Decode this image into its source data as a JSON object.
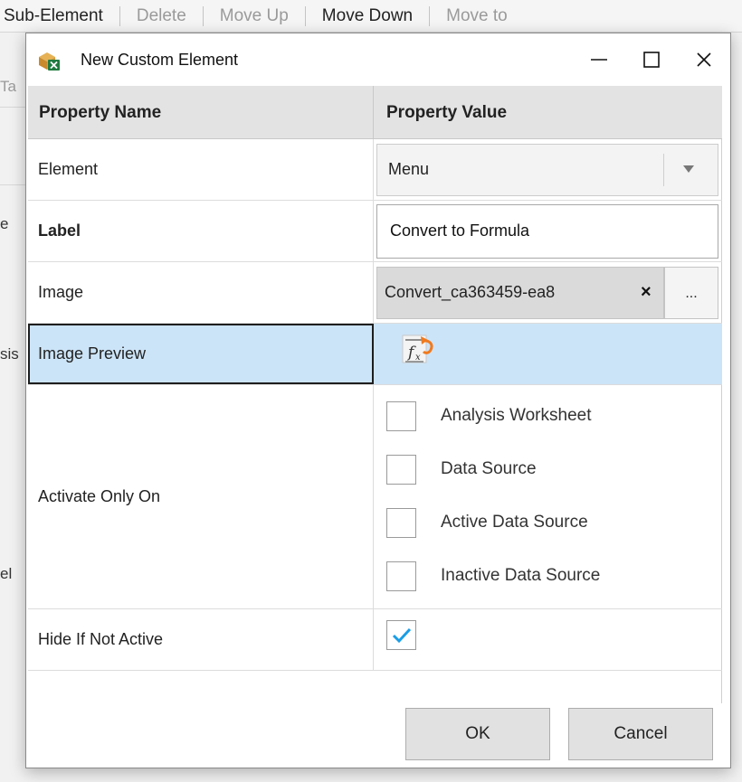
{
  "background": {
    "toolbar": [
      {
        "label": "Sub-Element",
        "enabled": true
      },
      {
        "label": "Delete",
        "enabled": false
      },
      {
        "label": "Move Up",
        "enabled": false
      },
      {
        "label": "Move Down",
        "enabled": true
      },
      {
        "label": "Move to",
        "enabled": false
      }
    ],
    "fragments": [
      "Ta",
      "e",
      "sis",
      "el"
    ]
  },
  "dialog": {
    "title": "New Custom Element",
    "icon": "custom-element-app-icon",
    "window_buttons": [
      "minimize-icon",
      "maximize-icon",
      "close-icon"
    ],
    "grid": {
      "header": {
        "name": "Property Name",
        "value": "Property Value"
      },
      "element": {
        "name": "Element",
        "value": "Menu"
      },
      "label": {
        "name": "Label",
        "value": "Convert to Formula"
      },
      "image": {
        "name": "Image",
        "value": "Convert_ca363459-ea8",
        "clear": "×",
        "browse": "..."
      },
      "image_preview": {
        "name": "Image Preview",
        "icon": "convert-to-formula-icon"
      },
      "activate_only_on": {
        "name": "Activate Only On",
        "options": [
          {
            "label": "Analysis Worksheet",
            "checked": false
          },
          {
            "label": "Data Source",
            "checked": false
          },
          {
            "label": "Active Data Source",
            "checked": false
          },
          {
            "label": "Inactive Data Source",
            "checked": false
          }
        ]
      },
      "hide_if_not_active": {
        "name": "Hide If Not Active",
        "checked": true
      }
    },
    "buttons": {
      "ok": "OK",
      "cancel": "Cancel"
    }
  },
  "colors": {
    "selection": "#cce4f7",
    "header": "#e3e3e3",
    "check_accent": "#1a9ee6"
  }
}
